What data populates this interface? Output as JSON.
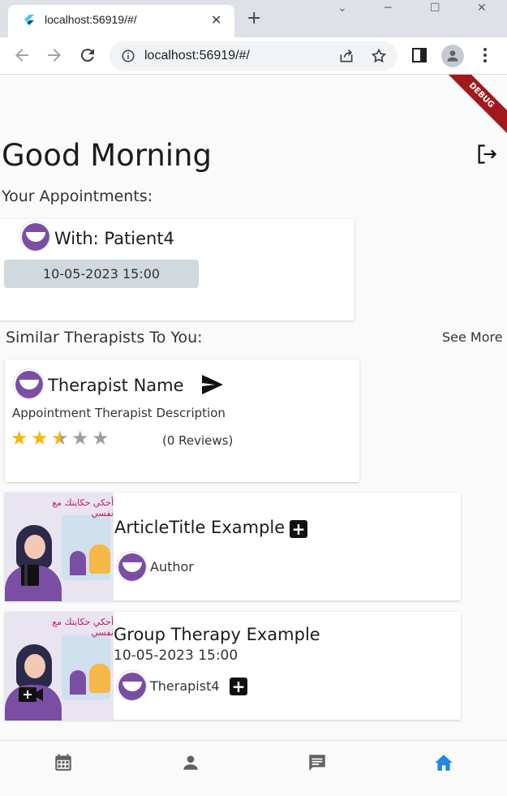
{
  "browser": {
    "tab_title": "localhost:56919/#/",
    "tab_close": "✕",
    "new_tab": "+",
    "url": "localhost:56919/#/",
    "min": "─",
    "max": "☐",
    "close": "✕",
    "chevron": "⌄"
  },
  "app": {
    "debug_banner": "DEBUG",
    "greeting": "Good Morning",
    "appointments_title": "Your Appointments:",
    "appointment": {
      "with": "With: Patient4",
      "datetime": "10-05-2023 15:00"
    },
    "similar_title": "Similar Therapists To You:",
    "see_more": "See More",
    "therapist": {
      "name": "Therapist Name",
      "description": "Appointment Therapist Description",
      "rating": 2.5,
      "rating_max": 5,
      "reviews": "(0 Reviews)"
    },
    "article": {
      "title": "ArticleTitle Example",
      "author": "Author",
      "thumb_caption": "أحكي حكايتك مع نفسي"
    },
    "group": {
      "title": "Group Therapy Example",
      "datetime": "10-05-2023 15:00",
      "therapist": "Therapist4",
      "thumb_caption": "أحكي حكايتك مع نفسي"
    },
    "nav": {
      "active": "home",
      "active_color": "#1e88e5",
      "inactive_color": "#616161"
    },
    "plus_label": "+"
  }
}
